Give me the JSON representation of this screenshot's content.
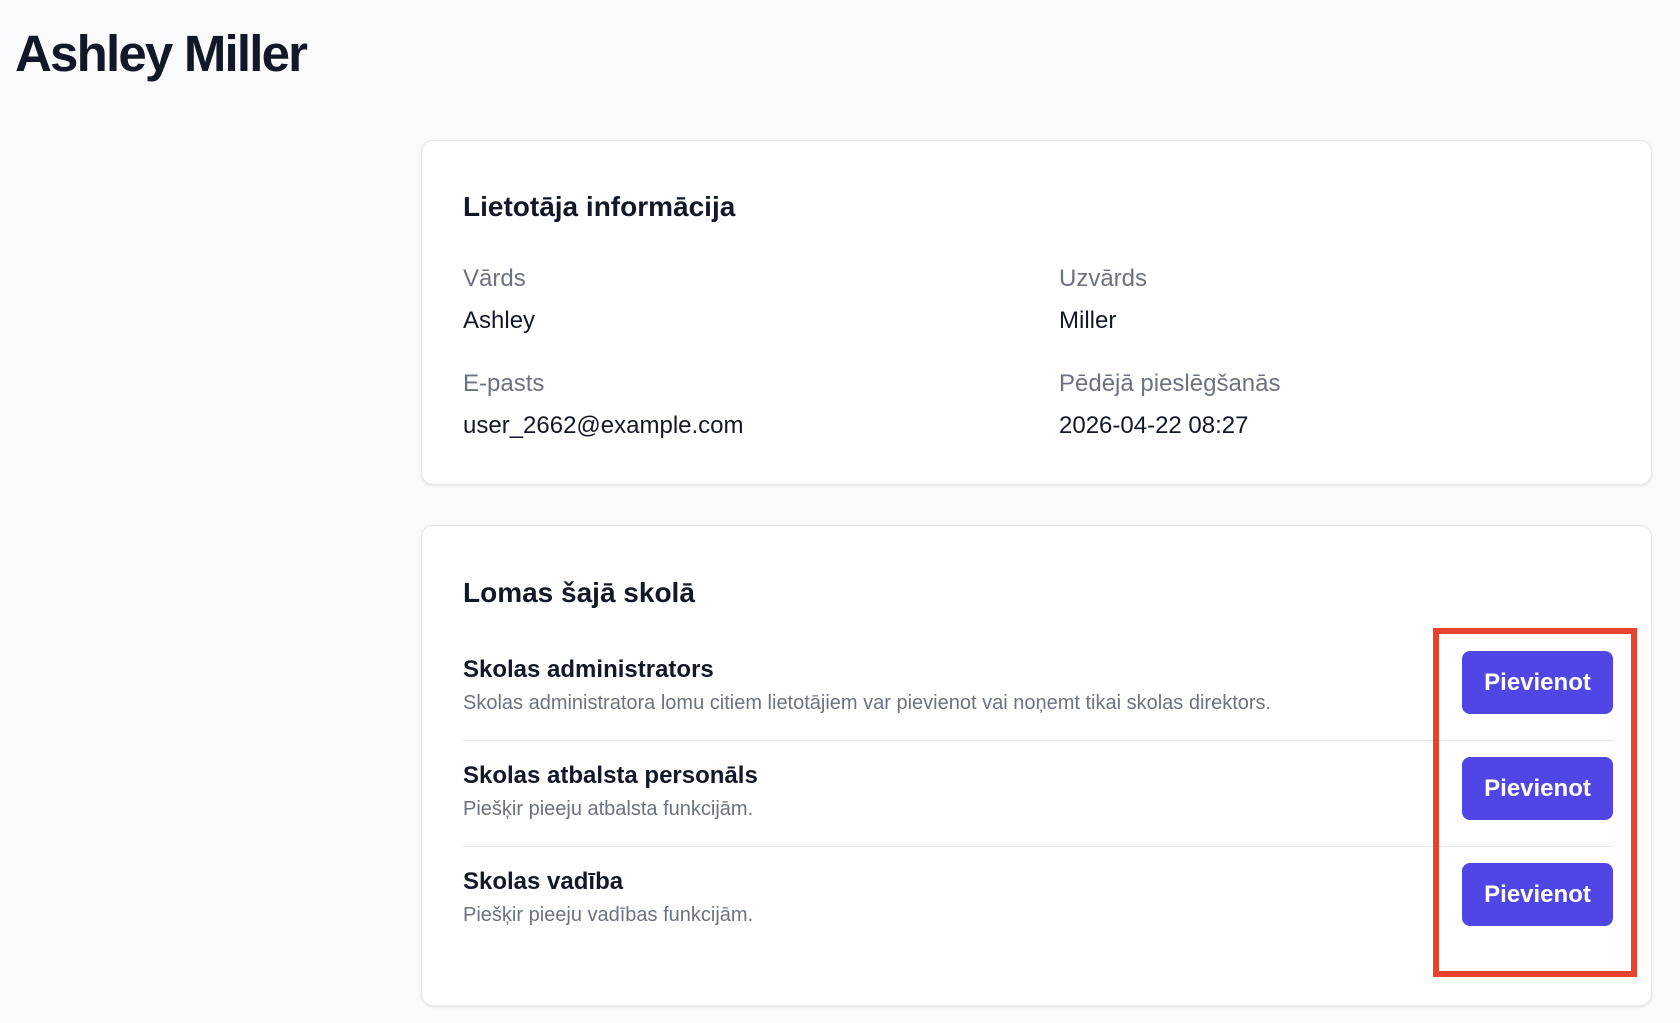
{
  "page": {
    "title": "Ashley Miller"
  },
  "user_info": {
    "title": "Lietotāja informācija",
    "first_name": {
      "label": "Vārds",
      "value": "Ashley"
    },
    "last_name": {
      "label": "Uzvārds",
      "value": "Miller"
    },
    "email": {
      "label": "E-pasts",
      "value": "user_2662@example.com"
    },
    "last_login": {
      "label": "Pēdējā pieslēgšanās",
      "value": "2026-04-22 08:27"
    }
  },
  "roles": {
    "title": "Lomas šajā skolā",
    "items": [
      {
        "name": "Skolas administrators",
        "description": "Skolas administratora lomu citiem lietotājiem var pievienot vai noņemt tikai skolas direktors.",
        "button_label": "Pievienot"
      },
      {
        "name": "Skolas atbalsta personāls",
        "description": "Piešķir pieeju atbalsta funkcijām.",
        "button_label": "Pievienot"
      },
      {
        "name": "Skolas vadība",
        "description": "Piešķir pieeju vadības funkcijām.",
        "button_label": "Pievienot"
      }
    ]
  },
  "colors": {
    "accent": "#4f46e5",
    "highlight": "#e8432e",
    "background": "#f9fafb"
  }
}
